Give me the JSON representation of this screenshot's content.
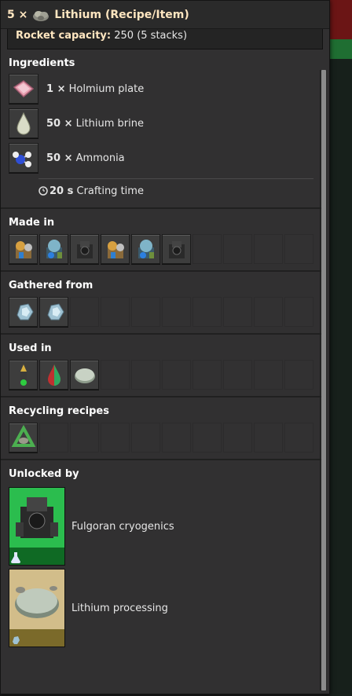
{
  "title": {
    "count": "5 ×",
    "icon": "lithium-icon",
    "name": "Lithium (Recipe/Item)"
  },
  "capacity": {
    "label": "Rocket capacity:",
    "value": "250 (5 stacks)"
  },
  "ingredients": {
    "heading": "Ingredients",
    "items": [
      {
        "amount": "1 ×",
        "name": "Holmium plate",
        "icon": "holmium-plate-icon"
      },
      {
        "amount": "50 ×",
        "name": "Lithium brine",
        "icon": "lithium-brine-icon"
      },
      {
        "amount": "50 ×",
        "name": "Ammonia",
        "icon": "ammonia-icon"
      }
    ],
    "time_value": "20 s",
    "time_label": "Crafting time"
  },
  "made_in": {
    "heading": "Made in",
    "icons": [
      "chemical-plant-icon",
      "cryogenic-plant-icon",
      "dark-assembler-icon",
      "chemical-plant-icon",
      "cryogenic-plant-icon",
      "dark-assembler-icon"
    ]
  },
  "gathered_from": {
    "heading": "Gathered from",
    "icons": [
      "lithium-ore-icon",
      "lithium-ore-icon"
    ]
  },
  "used_in": {
    "heading": "Used in",
    "icons": [
      "tower-icon",
      "fluid-drop-icon",
      "lithium-plate-icon"
    ]
  },
  "recycling": {
    "heading": "Recycling recipes",
    "icons": [
      "recycling-icon"
    ]
  },
  "unlocked_by": {
    "heading": "Unlocked by",
    "items": [
      {
        "name": "Fulgoran cryogenics",
        "icon": "cryogenic-plant-tech-icon"
      },
      {
        "name": "Lithium processing",
        "icon": "lithium-plate-tech-icon"
      }
    ]
  }
}
